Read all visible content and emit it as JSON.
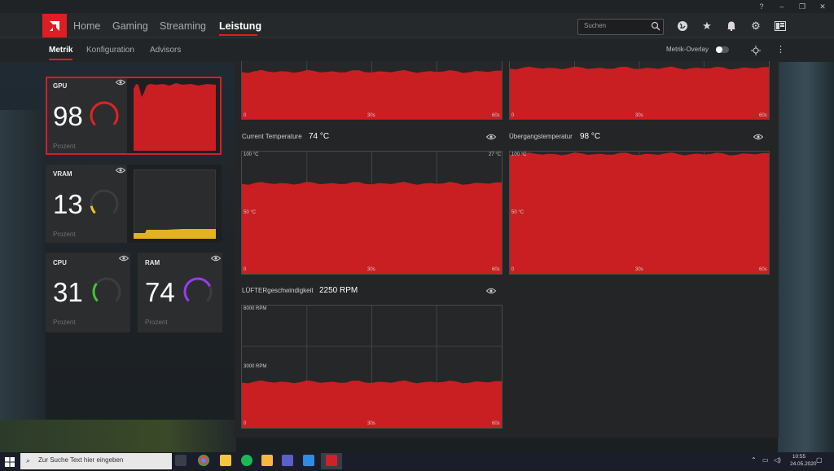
{
  "window": {
    "help": "?",
    "minimize": "–",
    "restore": "❐",
    "close": "✕"
  },
  "nav": {
    "tabs": [
      "Home",
      "Gaming",
      "Streaming",
      "Leistung"
    ],
    "active": "Leistung"
  },
  "search": {
    "placeholder": "Suchen"
  },
  "subnav": {
    "tabs": [
      "Metrik",
      "Konfiguration",
      "Advisors"
    ],
    "overlay_label": "Metrik-Overlay"
  },
  "cards": {
    "gpu": {
      "title": "GPU",
      "value": "98",
      "unit": "Prozent",
      "ring_color": "#e8201f",
      "ring_level": 0.98
    },
    "vram": {
      "title": "VRAM",
      "value": "13",
      "unit": "Prozent",
      "ring_color": "#f1c21c",
      "ring_level": 0.13
    },
    "cpu": {
      "title": "CPU",
      "value": "31",
      "unit": "Prozent",
      "ring_color": "#41c432",
      "ring_level": 0.31
    },
    "ram": {
      "title": "RAM",
      "value": "74",
      "unit": "Prozent",
      "ring_color": "#9a3bf0",
      "ring_level": 0.74
    }
  },
  "graphs": {
    "top_left": {
      "x_ticks": [
        "0",
        "30s",
        "60s"
      ],
      "level": 0.82,
      "color": "#c91f22"
    },
    "top_right": {
      "x_ticks": [
        "0",
        "30s",
        "60s"
      ],
      "level": 0.88,
      "color": "#c91f22"
    },
    "temp": {
      "title": "Current Temperature",
      "value": "74 °C",
      "y_top": "100 °C",
      "y_mid": "50 °C",
      "corner": "27 °C",
      "x_ticks": [
        "0",
        "30s",
        "60s"
      ],
      "level": 0.74
    },
    "junction": {
      "title": "Übergangstemperatur",
      "value": "98 °C",
      "y_top": "100 °C",
      "y_mid": "50 °C",
      "x_ticks": [
        "0",
        "30s",
        "60s"
      ],
      "level": 0.98
    },
    "fan": {
      "title": "LÜFTERgeschwindigkeit",
      "value": "2250 RPM",
      "y_top": "6000 RPM",
      "y_mid": "3000 RPM",
      "x_ticks": [
        "0",
        "30s",
        "60s"
      ],
      "level": 0.375
    }
  },
  "taskbar": {
    "search_text": "Zur Suche Text hier eingeben",
    "time": "10:55",
    "date": "24.05.2020"
  }
}
